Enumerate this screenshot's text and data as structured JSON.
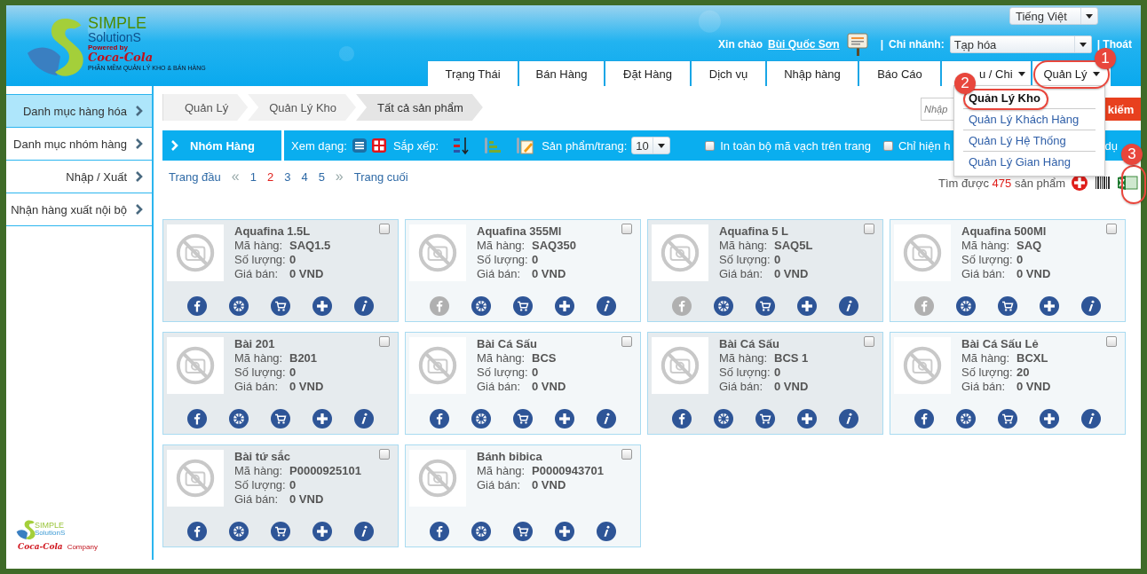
{
  "logo": {
    "name": "SIMPLE",
    "sub": "SolutionS",
    "powered": "Powered by",
    "brand": "Coca-Cola",
    "tagline": "PHẦN MỀM QUẢN LÝ KHO & BÁN HÀNG"
  },
  "language": "Tiếng Việt",
  "greeting": {
    "label": "Xin chào",
    "user": "Bùi Quốc Sơn"
  },
  "branch": {
    "separator": "|",
    "label": "Chi nhánh:",
    "value": "Tạp hóa"
  },
  "logout": "| Thoát",
  "nav": [
    {
      "label": "Trạng Thái",
      "dropdown": false
    },
    {
      "label": "Bán Hàng",
      "dropdown": false
    },
    {
      "label": "Đặt Hàng",
      "dropdown": false
    },
    {
      "label": "Dịch vụ",
      "dropdown": false
    },
    {
      "label": "Nhập hàng",
      "dropdown": false
    },
    {
      "label": "Báo Cáo",
      "dropdown": false
    },
    {
      "label": "u / Chi",
      "dropdown": true
    },
    {
      "label": "Quản Lý",
      "dropdown": true
    }
  ],
  "menu": [
    {
      "label": "Quản Lý Kho",
      "selected": true
    },
    {
      "label": "Quản Lý Khách Hàng",
      "selected": false
    },
    {
      "label": "Quản Lý Hệ Thống",
      "selected": false
    },
    {
      "label": "Quản Lý Gian Hàng",
      "selected": false
    }
  ],
  "sidebar": [
    {
      "label": "Danh mục hàng hóa",
      "selected": true
    },
    {
      "label": "Danh mục nhóm hàng",
      "selected": false
    },
    {
      "label": "Nhập / Xuất",
      "selected": false
    },
    {
      "label": "Nhận hàng xuất nội bộ",
      "selected": false
    }
  ],
  "sidebar_logo": {
    "name": "SIMPLE",
    "sub": "SolutionS",
    "brand": "Coca-Cola",
    "company": "Company"
  },
  "breadcrumb": [
    "Quản Lý",
    "Quản Lý Kho",
    "Tất cả sản phẩm"
  ],
  "search": {
    "placeholder": "Nhập",
    "button": "kiếm"
  },
  "toolbar": {
    "group": "Nhóm Hàng",
    "view_label": "Xem dạng:",
    "sort_label": "Sắp xếp:",
    "per_page_label": "Sản phẩm/trang:",
    "per_page": "10",
    "checks": [
      {
        "label": "In toàn bộ mã vạch trên trang",
        "checked": false
      },
      {
        "label": "Chỉ hiện h",
        "checked": false
      }
    ],
    "tail": "dụ"
  },
  "pagination": {
    "first": "Trang đầu",
    "prev": "«",
    "next": "»",
    "last": "Trang cuối",
    "pages": [
      {
        "label": "1",
        "selected": false
      },
      {
        "label": "2",
        "selected": true
      },
      {
        "label": "3",
        "selected": false
      },
      {
        "label": "4",
        "selected": false
      },
      {
        "label": "5",
        "selected": false
      }
    ]
  },
  "result": {
    "prefix": "Tìm được",
    "count": "475",
    "suffix": "sản phẩm"
  },
  "products": [
    {
      "name": "Aquafina 1.5L",
      "checked": false,
      "facebook_enabled": true,
      "fields": [
        {
          "label": "Mã hàng:",
          "value": "SAQ1.5"
        },
        {
          "label": "Số lượng:",
          "value": "0"
        },
        {
          "label": "Giá bán:",
          "value": "0 VND"
        }
      ]
    },
    {
      "name": "Aquafina 355Ml",
      "checked": false,
      "facebook_enabled": false,
      "fields": [
        {
          "label": "Mã hàng:",
          "value": "SAQ350"
        },
        {
          "label": "Số lượng:",
          "value": "0"
        },
        {
          "label": "Giá bán:",
          "value": "0 VND"
        }
      ]
    },
    {
      "name": "Aquafina 5 L",
      "checked": false,
      "facebook_enabled": false,
      "fields": [
        {
          "label": "Mã hàng:",
          "value": "SAQ5L"
        },
        {
          "label": "Số lượng:",
          "value": "0"
        },
        {
          "label": "Giá bán:",
          "value": "0 VND"
        }
      ]
    },
    {
      "name": "Aquafina 500Ml",
      "checked": false,
      "facebook_enabled": false,
      "fields": [
        {
          "label": "Mã hàng:",
          "value": "SAQ"
        },
        {
          "label": "Số lượng:",
          "value": "0"
        },
        {
          "label": "Giá bán:",
          "value": "0 VND"
        }
      ]
    },
    {
      "name": "Bài 201",
      "checked": false,
      "facebook_enabled": true,
      "fields": [
        {
          "label": "Mã hàng:",
          "value": "B201"
        },
        {
          "label": "Số lượng:",
          "value": "0"
        },
        {
          "label": "Giá bán:",
          "value": "0 VND"
        }
      ]
    },
    {
      "name": "Bài Cá Sấu",
      "checked": false,
      "facebook_enabled": true,
      "fields": [
        {
          "label": "Mã hàng:",
          "value": "BCS"
        },
        {
          "label": "Số lượng:",
          "value": "0"
        },
        {
          "label": "Giá bán:",
          "value": "0 VND"
        }
      ]
    },
    {
      "name": "Bài Cá Sấu",
      "checked": false,
      "facebook_enabled": true,
      "fields": [
        {
          "label": "Mã hàng:",
          "value": "BCS 1"
        },
        {
          "label": "Số lượng:",
          "value": "0"
        },
        {
          "label": "Giá bán:",
          "value": "0 VND"
        }
      ]
    },
    {
      "name": "Bài Cá Sấu Lẻ",
      "checked": false,
      "facebook_enabled": true,
      "fields": [
        {
          "label": "Mã hàng:",
          "value": "BCXL"
        },
        {
          "label": "Số lượng:",
          "value": "20"
        },
        {
          "label": "Giá bán:",
          "value": "0 VND"
        }
      ]
    },
    {
      "name": "Bài tứ sắc",
      "checked": false,
      "facebook_enabled": true,
      "fields": [
        {
          "label": "Mã hàng:",
          "value": "P0000925101"
        },
        {
          "label": "Số lượng:",
          "value": "0"
        },
        {
          "label": "Giá bán:",
          "value": "0 VND"
        }
      ]
    },
    {
      "name": "Bánh bibica",
      "checked": false,
      "facebook_enabled": true,
      "fields": [
        {
          "label": "Mã hàng:",
          "value": "P0000943701"
        },
        {
          "label": "Giá bán:",
          "value": "0 VND"
        }
      ]
    }
  ],
  "annotations": [
    {
      "number": "1"
    },
    {
      "number": "2"
    },
    {
      "number": "3"
    }
  ]
}
